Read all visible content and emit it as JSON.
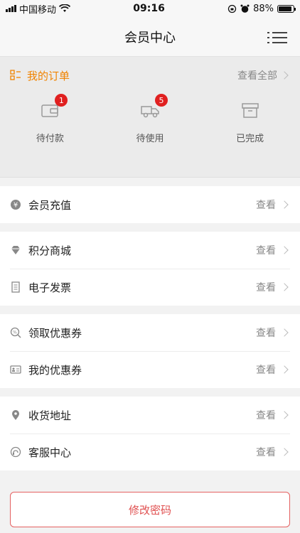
{
  "status_bar": {
    "carrier": "中国移动",
    "time": "09:16",
    "battery": "88%",
    "battery_level": 0.88
  },
  "header": {
    "title": "会员中心"
  },
  "orders": {
    "title": "我的订单",
    "view_all": "查看全部",
    "items": [
      {
        "label": "待付款",
        "badge": "1",
        "icon": "wallet-icon"
      },
      {
        "label": "待使用",
        "badge": "5",
        "icon": "delivery-truck-icon"
      },
      {
        "label": "已完成",
        "badge": "",
        "icon": "archive-box-icon"
      }
    ]
  },
  "menu": {
    "recharge": {
      "label": "会员充值",
      "action": "查看",
      "icon": "yen-coin-icon"
    },
    "mall": {
      "label": "积分商城",
      "action": "查看",
      "icon": "diamond-icon"
    },
    "invoice": {
      "label": "电子发票",
      "action": "查看",
      "icon": "document-icon"
    },
    "get_coupon": {
      "label": "领取优惠券",
      "action": "查看",
      "icon": "coupon-search-icon"
    },
    "my_coupon": {
      "label": "我的优惠券",
      "action": "查看",
      "icon": "id-card-icon"
    },
    "address": {
      "label": "收货地址",
      "action": "查看",
      "icon": "location-pin-icon"
    },
    "service": {
      "label": "客服中心",
      "action": "查看",
      "icon": "headset-icon"
    }
  },
  "footer": {
    "change_password": "修改密码"
  },
  "colors": {
    "accent": "#f08300",
    "badge": "#e02020",
    "danger_outline": "#e46060"
  }
}
